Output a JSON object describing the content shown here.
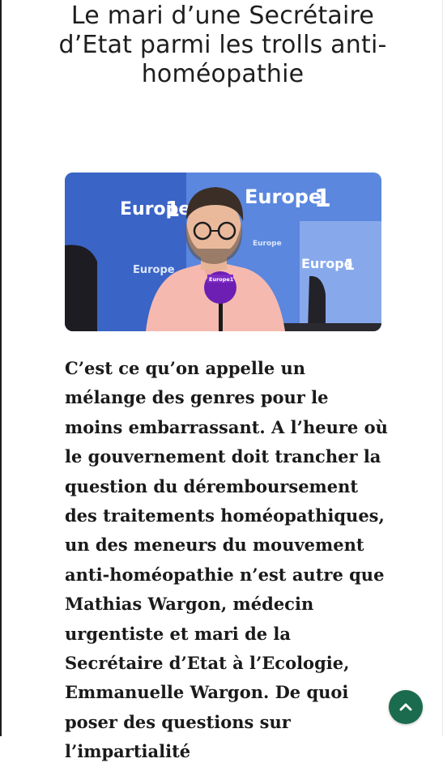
{
  "article": {
    "title": "Le mari d’une Secrétaire d’Etat parmi les trolls anti-homéopathie",
    "body": "C’est ce qu’on appelle un mélange des genres pour le moins embarrassant. A l’heure où le gouvernement doit trancher la question du déremboursement des traitements homéopathiques, un des meneurs du mouvement anti-homéopathie n’est autre que Mathias Wargon, médecin urgentiste et mari de la Secrétaire d’Etat à l’Ecologie, Emmanuelle Wargon. De quoi poser des questions sur l’impartialité"
  },
  "hero_image": {
    "brand_text": "Europe 1",
    "brand_large": "Europe",
    "brand_digit": "1",
    "mic_label": "Europe1"
  },
  "ui": {
    "scroll_top_icon": "chevron-up-icon",
    "scroll_top_color": "#1b6b4e"
  },
  "colors": {
    "title": "#1e1e1e",
    "body": "#1a1a1a",
    "hero_blue": "#3b66c9"
  }
}
